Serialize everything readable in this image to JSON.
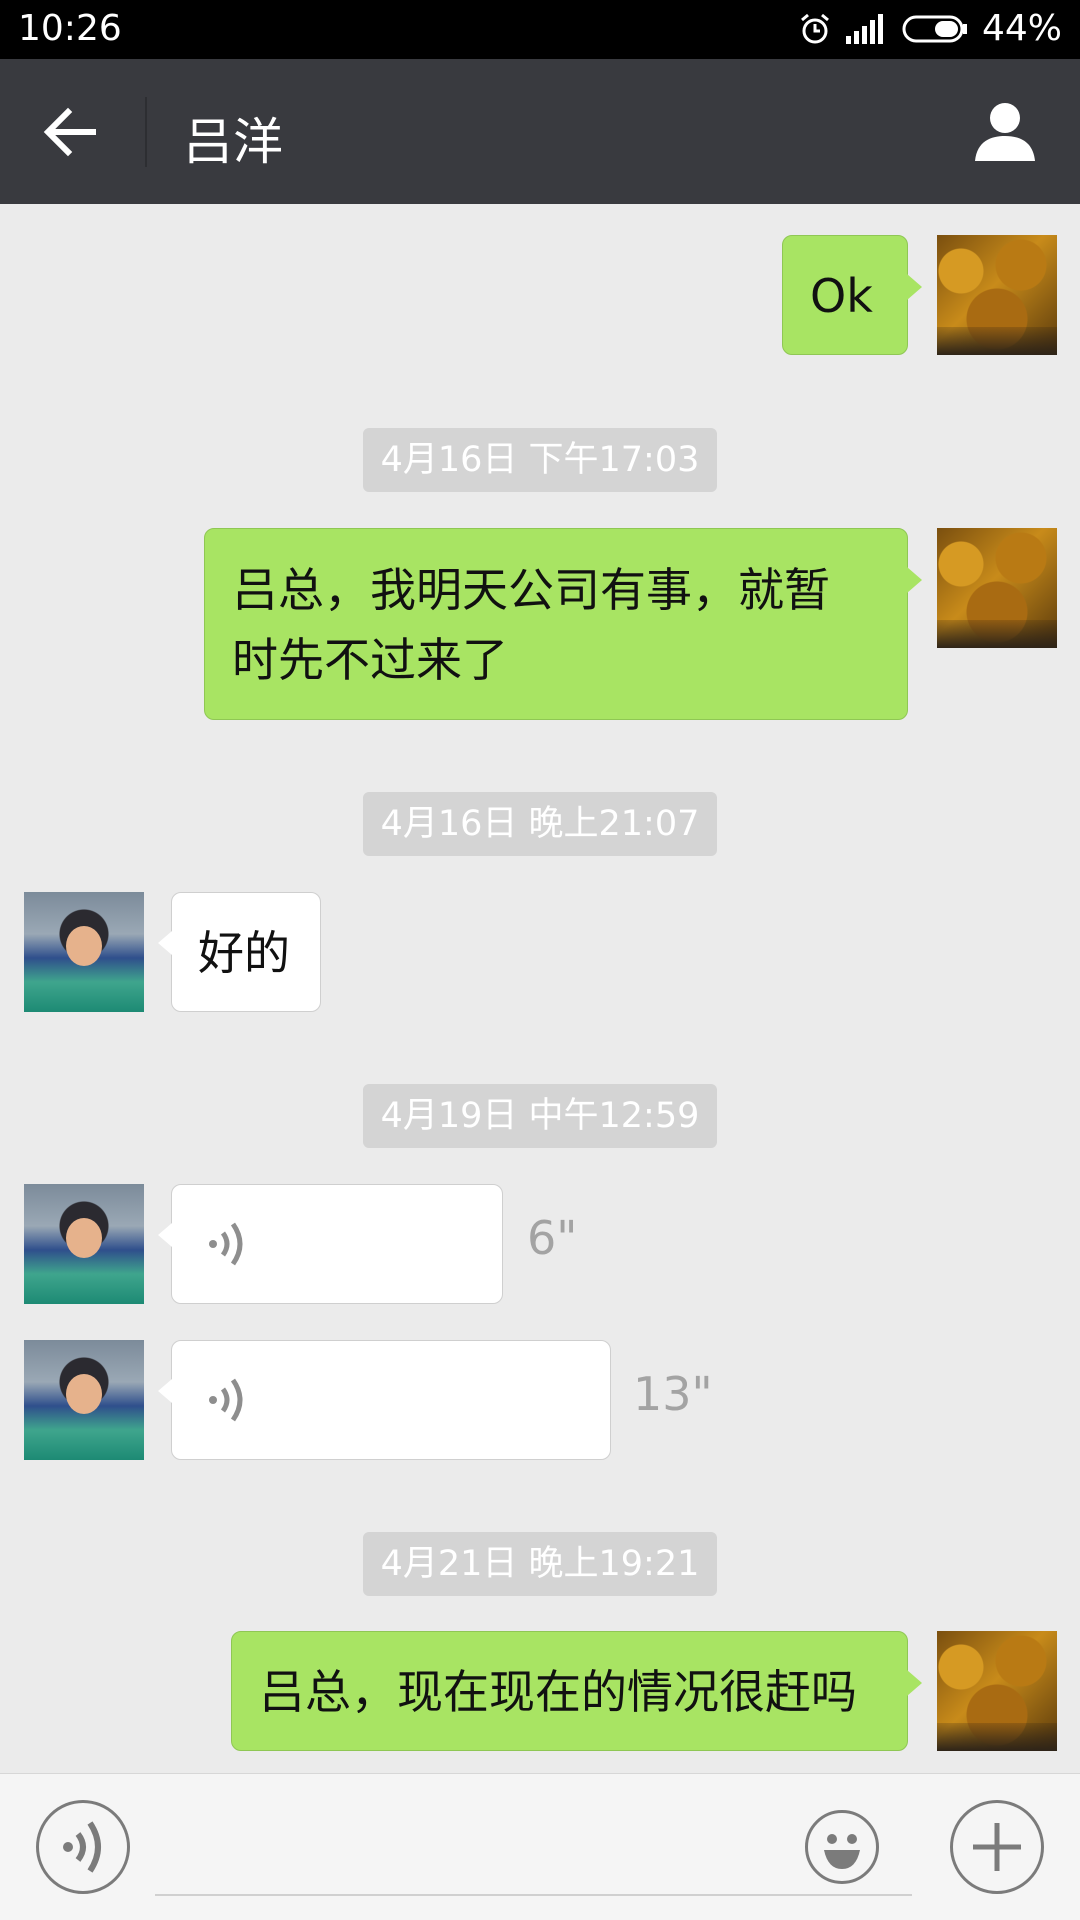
{
  "status_bar": {
    "time": "10:26",
    "battery": "44%"
  },
  "header": {
    "title": "吕洋"
  },
  "messages": [
    {
      "text": "Ok"
    },
    {
      "time": "4月16日 下午17:03"
    },
    {
      "text_line1": "吕总，我明天公司有事，就暂",
      "text_line2": "时先不过来了"
    },
    {
      "time": "4月16日 晚上21:07"
    },
    {
      "text": "好的"
    },
    {
      "time": "4月19日 中午12:59"
    },
    {
      "duration": "6\""
    },
    {
      "duration": "13\""
    },
    {
      "time": "4月21日 晚上19:21"
    },
    {
      "text": "吕总，现在现在的情况很赶吗"
    }
  ],
  "colors": {
    "sent_bubble": "#a8e463",
    "received_bubble": "#ffffff",
    "header_bg": "#393a3f",
    "chat_bg": "#ebebeb"
  }
}
